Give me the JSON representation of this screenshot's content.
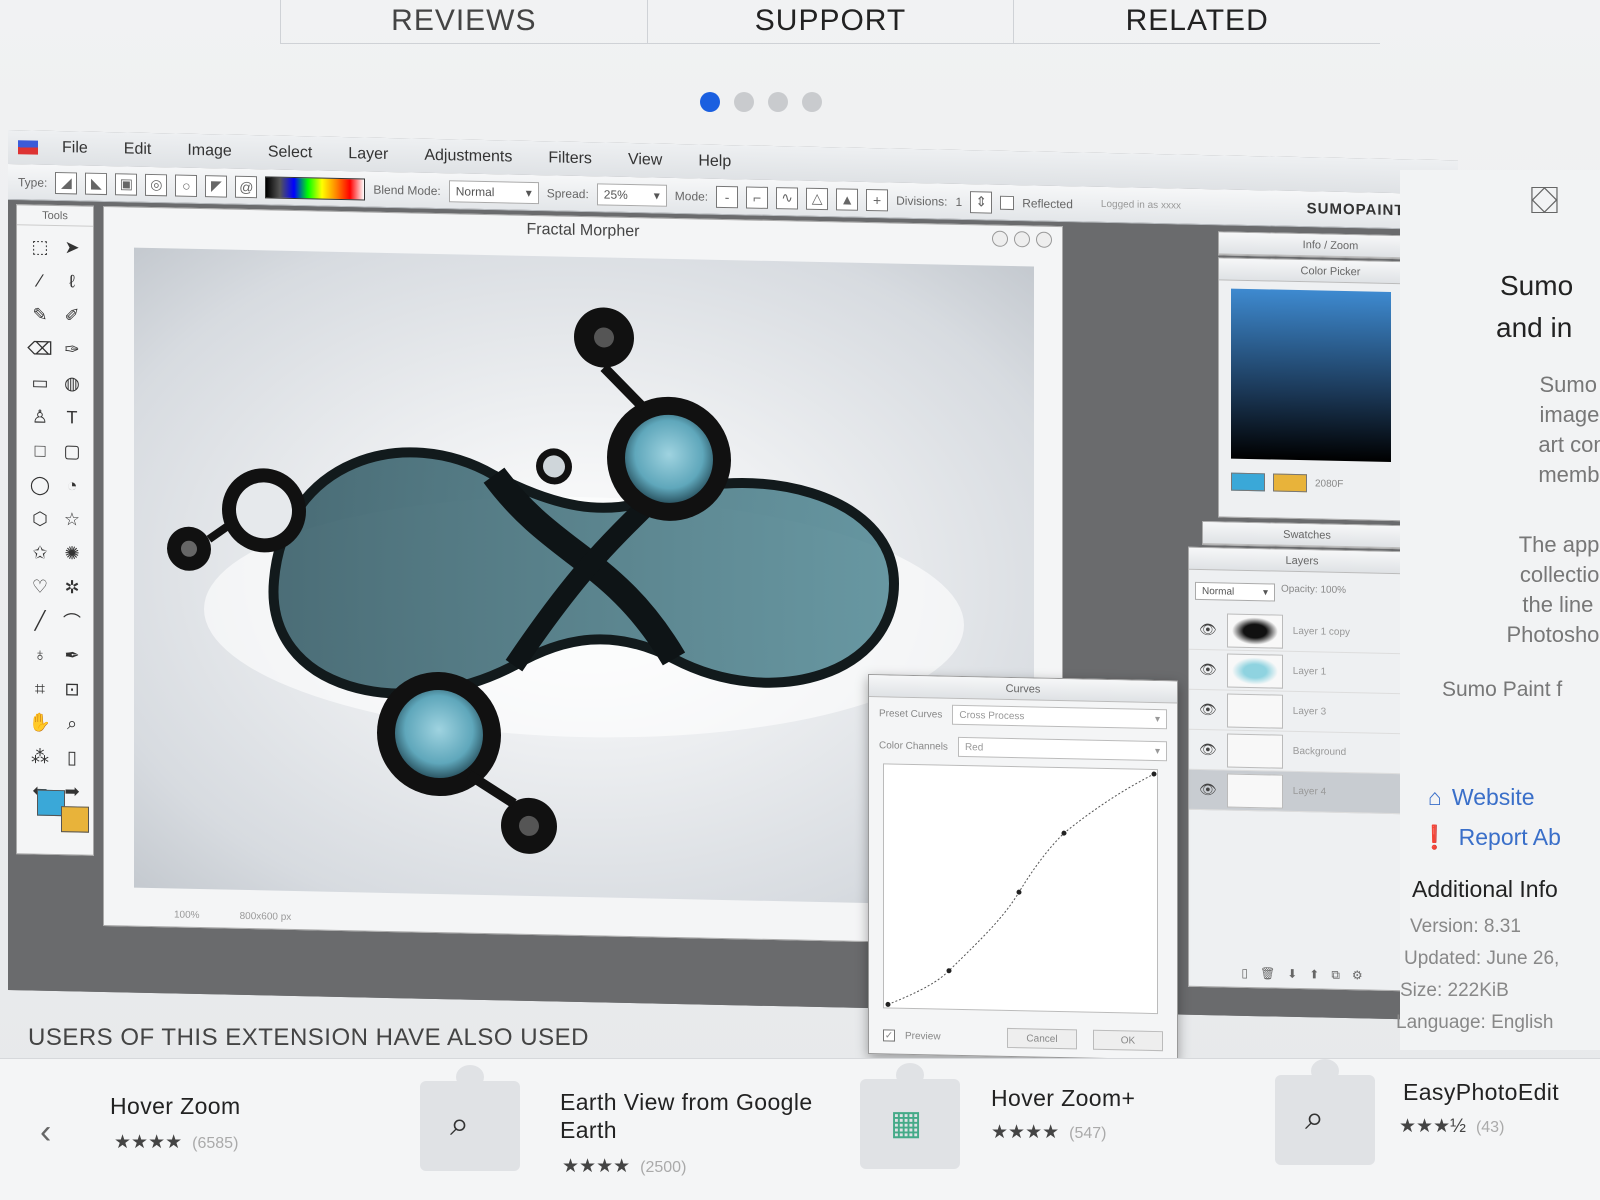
{
  "store": {
    "tabs": [
      "REVIEWS",
      "SUPPORT",
      "RELATED"
    ],
    "carousel_dots": 4,
    "carousel_active": 0
  },
  "app": {
    "menu": [
      "File",
      "Edit",
      "Image",
      "Select",
      "Layer",
      "Adjustments",
      "Filters",
      "View",
      "Help"
    ],
    "toolbar": {
      "type_label": "Type:",
      "blend_mode_label": "Blend Mode:",
      "blend_mode_value": "Normal",
      "spread_label": "Spread:",
      "spread_value": "25%",
      "mode_label": "Mode:",
      "divisions_label": "Divisions:",
      "divisions_value": "1",
      "reflected_label": "Reflected",
      "logged_in": "Logged in as xxxx",
      "brand": "SUMOPAINT.COM"
    },
    "tools_title": "Tools",
    "canvas": {
      "title": "Fractal Morpher",
      "zoom": "100%",
      "size": "800x600 px"
    },
    "panels": {
      "info_zoom": "Info / Zoom",
      "color_picker": "Color Picker",
      "color_hex": "2080F",
      "swatches": "Swatches",
      "layers": "Layers",
      "layers_mode": "Normal",
      "layers_opacity": "Opacity: 100%",
      "layer_names": [
        "Layer 1 copy",
        "Layer 1",
        "Layer 3",
        "Background",
        "Layer 4"
      ]
    },
    "curves": {
      "title": "Curves",
      "preset_label": "Preset Curves",
      "preset_value": "Cross Process",
      "channel_label": "Color Channels",
      "channel_value": "Red",
      "preview_label": "Preview",
      "cancel_label": "Cancel",
      "ok_label": "OK"
    }
  },
  "sidebar": {
    "title_line1": "Sumo",
    "title_line2": "and in",
    "desc": [
      "Sumo Pa",
      "image ed",
      "art comm",
      "members"
    ],
    "desc2": [
      "The app ha",
      "collection o",
      "the line bet",
      "Photoshop a"
    ],
    "desc3": "Sumo Paint f",
    "website": "Website",
    "report": "Report Ab",
    "additional": "Additional Info",
    "version": "Version: 8.31",
    "updated": "Updated: June 26,",
    "size": "Size: 222KiB",
    "language": "Language: English"
  },
  "related": {
    "heading": "USERS OF THIS EXTENSION HAVE ALSO USED",
    "items": [
      {
        "name": "Hover Zoom",
        "stars": "★★★★",
        "count": "(6585)"
      },
      {
        "name": "Earth View from Google",
        "name2": "Earth",
        "stars": "★★★★",
        "count": "(2500)"
      },
      {
        "name": "Hover Zoom+",
        "stars": "★★★★",
        "count": "(547)"
      },
      {
        "name": "EasyPhotoEdit",
        "stars": "★★★½",
        "count": "(43)"
      }
    ]
  },
  "colors": {
    "accent": "#1a5fe0",
    "link": "#3a6fc9",
    "fg_color": "#3aa8d8",
    "bg_color": "#e8b33a"
  }
}
